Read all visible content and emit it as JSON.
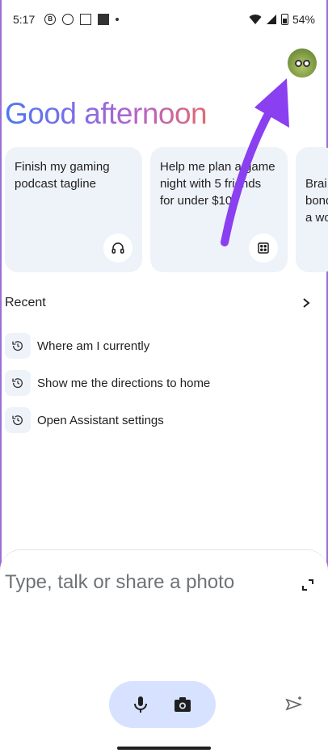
{
  "status_bar": {
    "time": "5:17",
    "icons": [
      "business-icon",
      "whatsapp-icon",
      "screenshot-icon",
      "app-icon",
      "dot-icon"
    ],
    "battery_percent": "54%",
    "signal_icon": "wifi-icon"
  },
  "greeting": "Good afternoon",
  "cards": [
    {
      "text": "Finish my gaming podcast tagline",
      "icon": "headphones-icon"
    },
    {
      "text": "Help me plan a game night with 5 friends for under $100",
      "icon": "dice-icon"
    },
    {
      "text": "Brai bond a wo",
      "icon": ""
    }
  ],
  "recent": {
    "title": "Recent",
    "items": [
      {
        "label": "Where am I currently"
      },
      {
        "label": "Show me the directions to home"
      },
      {
        "label": "Open Assistant settings"
      }
    ]
  },
  "input": {
    "placeholder": "Type, talk or share a photo"
  },
  "colors": {
    "accent_arrow": "#8a3ff0",
    "pill_bg": "#d6e2ff",
    "card_bg": "#eef2f9",
    "greeting_gradient": [
      "#4c78f0",
      "#b663c9",
      "#e06b72"
    ]
  }
}
